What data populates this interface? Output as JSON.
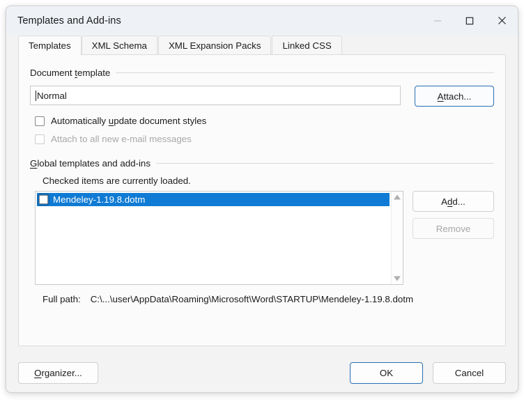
{
  "window": {
    "title": "Templates and Add-ins",
    "caption": {
      "minimize": "minimize-icon",
      "maximize": "maximize-icon",
      "close": "close-icon"
    }
  },
  "tabs": [
    {
      "label": "Templates",
      "active": true
    },
    {
      "label": "XML Schema",
      "active": false
    },
    {
      "label": "XML Expansion Packs",
      "active": false
    },
    {
      "label": "Linked CSS",
      "active": false
    }
  ],
  "document_template": {
    "group_label_pre": "Document ",
    "group_label_accel": "t",
    "group_label_post": "emplate",
    "field_value": "Normal",
    "attach_button": {
      "pre": "",
      "accel": "A",
      "post": "ttach..."
    },
    "checkbox_auto_update": {
      "pre": "Automatically ",
      "accel": "u",
      "post": "pdate document styles",
      "checked": false,
      "enabled": true
    },
    "checkbox_attach_email": {
      "pre": "Attach to all new e-mail messages",
      "accel": "",
      "post": "",
      "checked": false,
      "enabled": false
    }
  },
  "global_templates": {
    "group_label_pre": "",
    "group_label_accel": "G",
    "group_label_post": "lobal templates and add-ins",
    "hint": "Checked items are currently loaded.",
    "items": [
      {
        "label": "Mendeley-1.19.8.dotm",
        "checked": false,
        "selected": true
      }
    ],
    "add_button": {
      "pre": "A",
      "accel": "d",
      "post": "d..."
    },
    "remove_button": {
      "pre": "Remove",
      "accel": "",
      "post": "",
      "enabled": false
    },
    "full_path_label": "Full path:",
    "full_path_value": "C:\\...\\user\\AppData\\Roaming\\Microsoft\\Word\\STARTUP\\Mendeley-1.19.8.dotm",
    "scroll_up_icon": "scroll-up-arrow-icon",
    "scroll_down_icon": "scroll-down-arrow-icon"
  },
  "footer": {
    "organizer": {
      "pre": "",
      "accel": "O",
      "post": "rganizer..."
    },
    "ok": "OK",
    "cancel": "Cancel"
  },
  "colors": {
    "accent": "#0f7bd4",
    "focus_border": "#2a6fb4",
    "titlebar_bg": "#eef1f6",
    "panel_bg": "#fbfbfb",
    "window_bg": "#f3f3f3",
    "disabled_text": "#a8a8a8"
  }
}
